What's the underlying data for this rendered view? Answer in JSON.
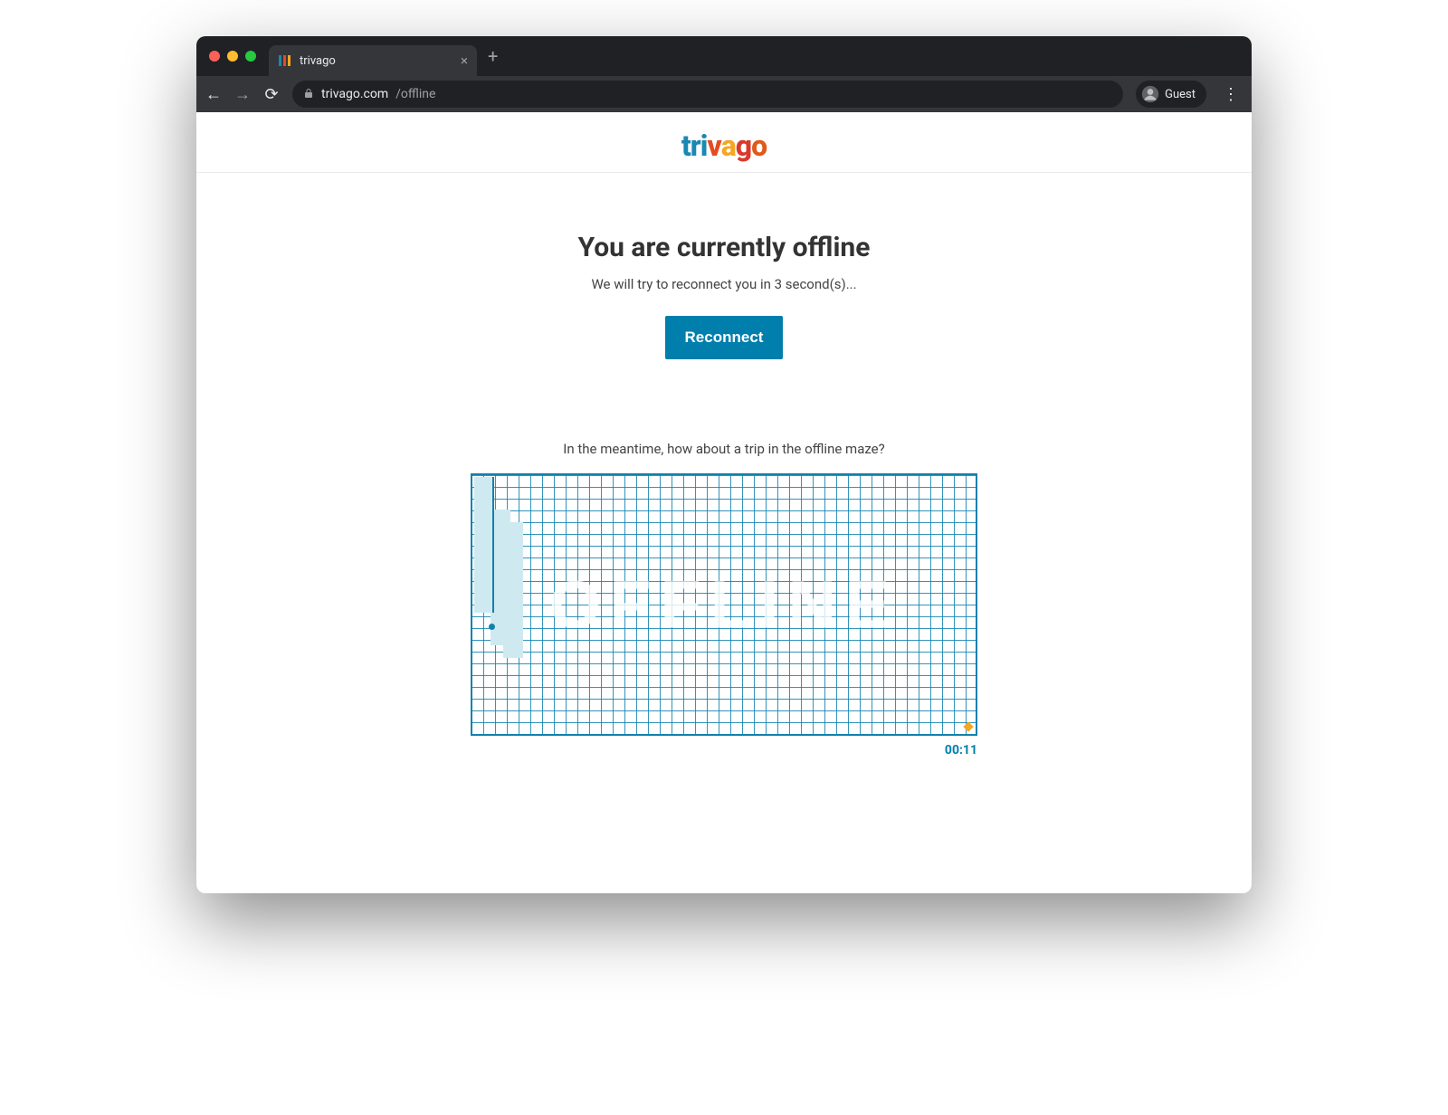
{
  "browser": {
    "tab_title": "trivago",
    "url_host": "trivago.com",
    "url_path": "/offline",
    "profile_label": "Guest"
  },
  "logo": {
    "text": "trivago"
  },
  "offline": {
    "heading": "You are currently offline",
    "subtext": "We will try to reconnect you in 3 second(s)...",
    "button_label": "Reconnect",
    "maze_intro": "In the meantime, how about a trip in the offline maze?",
    "maze_text": "OFFLINE",
    "timer": "00:11"
  }
}
